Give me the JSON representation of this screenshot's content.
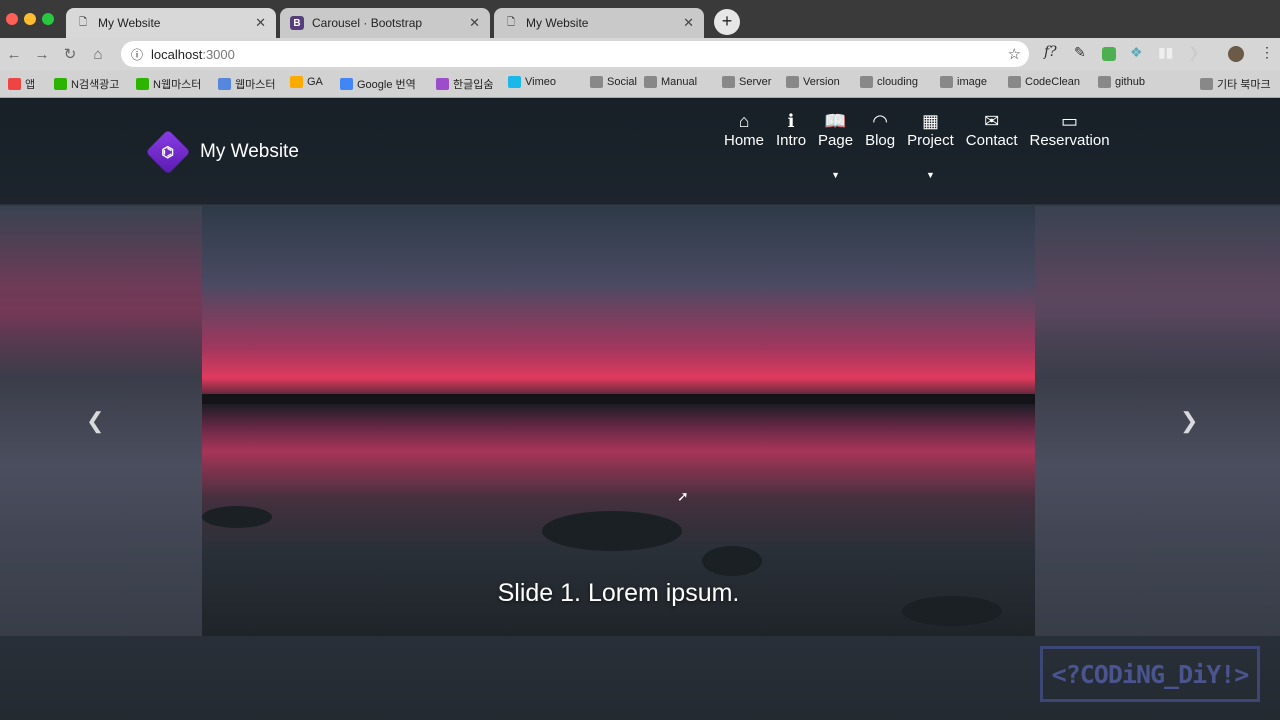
{
  "browser": {
    "tabs": [
      {
        "title": "My Website",
        "icon": "page-icon",
        "active": true
      },
      {
        "title": "Carousel · Bootstrap",
        "icon": "bootstrap-icon",
        "active": false
      },
      {
        "title": "My Website",
        "icon": "page-icon",
        "active": false
      }
    ],
    "url_host": "localhost",
    "url_port": ":3000",
    "bookmarks": [
      "앱",
      "N검색광고",
      "N웹마스터",
      "웹마스터",
      "GA",
      "Google 번역",
      "한글입숨",
      "Vimeo",
      "Social",
      "Manual",
      "Server",
      "Version",
      "clouding",
      "image",
      "CodeClean",
      "github",
      "기타 북마크"
    ]
  },
  "site": {
    "brand": "My Website",
    "brand_color": "#7b2fd6",
    "nav": [
      {
        "label": "Home",
        "icon": "home-icon"
      },
      {
        "label": "Intro",
        "icon": "info-icon"
      },
      {
        "label": "Page",
        "icon": "book-icon",
        "dropdown": true
      },
      {
        "label": "Blog",
        "icon": "rss-icon"
      },
      {
        "label": "Project",
        "icon": "grid-icon",
        "dropdown": true
      },
      {
        "label": "Contact",
        "icon": "envelope-icon"
      },
      {
        "label": "Reservation",
        "icon": "monitor-icon"
      }
    ],
    "carousel": {
      "caption": "Slide 1. Lorem ipsum.",
      "active_slide": 1
    }
  },
  "watermark": "<?CODiNG_DiY!>"
}
